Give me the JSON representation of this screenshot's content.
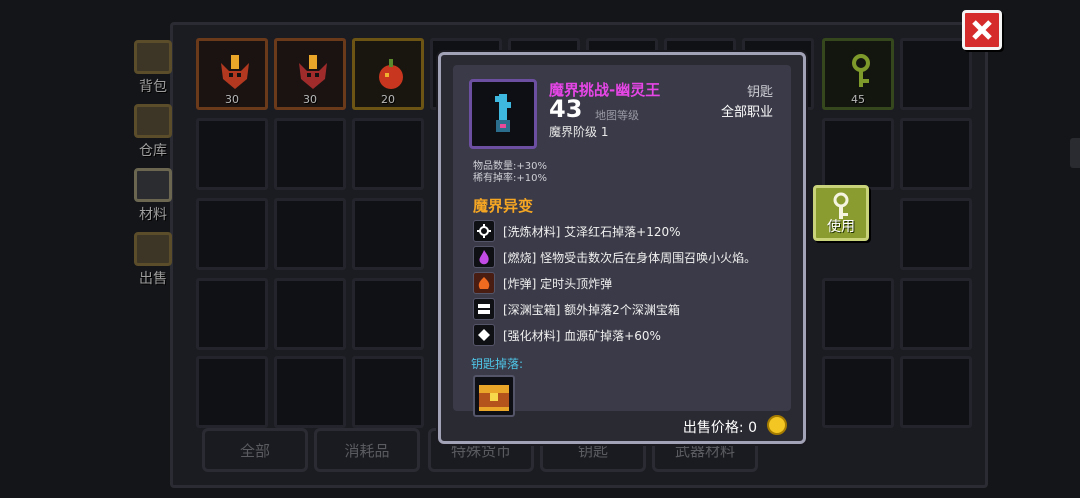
{
  "side_tabs": [
    "背包",
    "仓库",
    "材料",
    "出售"
  ],
  "bottom_tabs": [
    "全部",
    "消耗品",
    "特殊货币",
    "钥匙",
    "武器材料"
  ],
  "inventory_counts": [
    "30",
    "30",
    "20",
    "45"
  ],
  "tooltip": {
    "title": "魔界挑战-幽灵王",
    "level_value": "43",
    "level_label": "地图等级",
    "tier": "魔界阶级 1",
    "item_type": "钥匙",
    "class_req": "全部职业",
    "stat_quantity": "物品数量:+30%",
    "stat_rare": "稀有掉率:+10%",
    "section_title": "魔界异变",
    "modifiers": [
      "[洗炼材料] 艾泽红石掉落+120%",
      "[燃烧] 怪物受击数次后在身体周围召唤小火焰。",
      "[炸弹] 定时头顶炸弹",
      "[深渊宝箱] 额外掉落2个深渊宝箱",
      "[强化材料] 血源矿掉落+60%"
    ],
    "drops_label": "钥匙掉落:",
    "sell_label": "出售价格: 0"
  },
  "use_button": "使用",
  "colors": {
    "title": "#e646e6",
    "section": "#f5a623",
    "drops": "#4fc6e8",
    "close": "#d52b2b",
    "use": "#8a9b2f"
  }
}
